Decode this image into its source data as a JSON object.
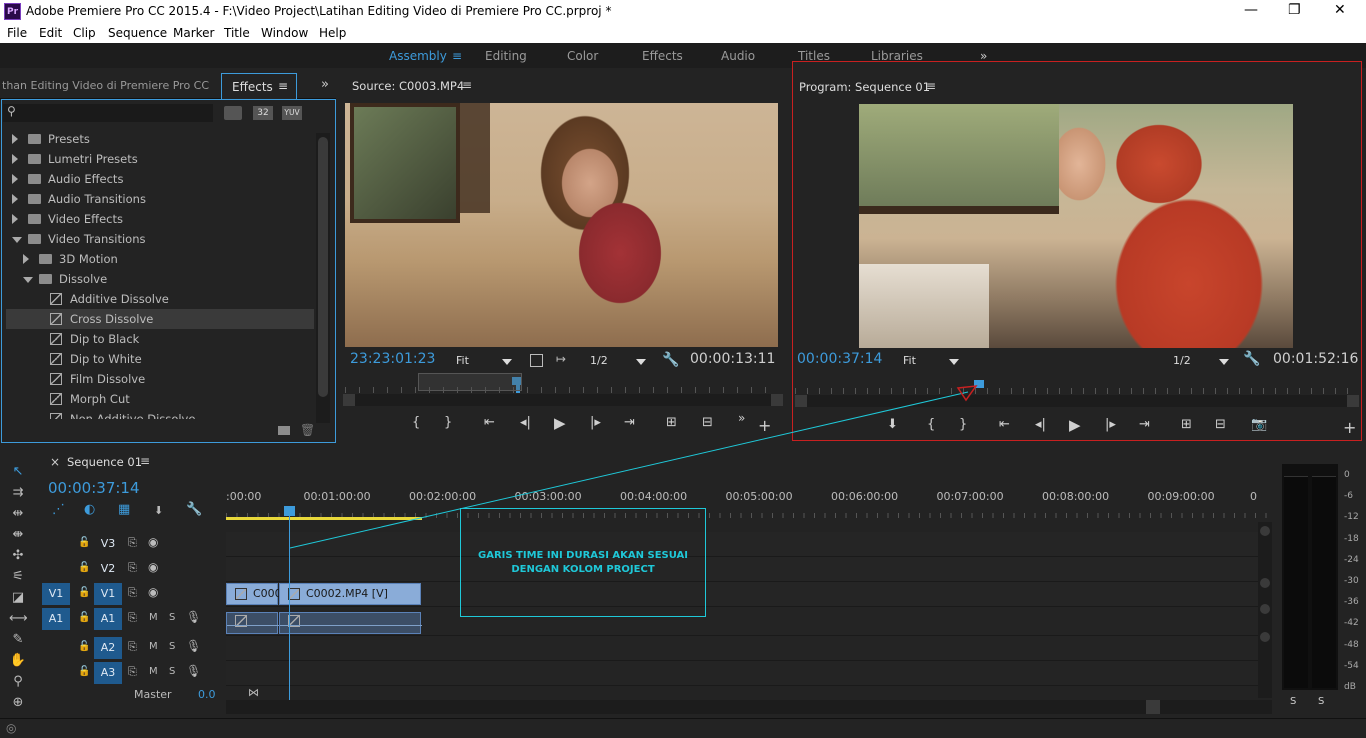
{
  "titlebar": {
    "logo": "Pr",
    "title": "Adobe Premiere Pro CC 2015.4 - F:\\Video Project\\Latihan Editing Video di Premiere Pro CC.prproj *",
    "minimize": "—",
    "restore": "❐",
    "close": "✕"
  },
  "menu": [
    "File",
    "Edit",
    "Clip",
    "Sequence",
    "Marker",
    "Title",
    "Window",
    "Help"
  ],
  "workspaces": {
    "active": "Assembly",
    "items": [
      "Editing",
      "Color",
      "Effects",
      "Audio",
      "Titles",
      "Libraries"
    ],
    "overflow": "»"
  },
  "project_panel": {
    "tab_project": "than Editing Video di Premiere Pro CC",
    "tab_effects": "Effects",
    "menu_icon": "≡",
    "overflow": "»",
    "badges": [
      "32",
      "YUV"
    ],
    "tree": [
      {
        "label": "Presets",
        "expanded": false,
        "level": 0,
        "type": "preset"
      },
      {
        "label": "Lumetri Presets",
        "expanded": false,
        "level": 0,
        "type": "preset"
      },
      {
        "label": "Audio Effects",
        "expanded": false,
        "level": 0,
        "type": "folder"
      },
      {
        "label": "Audio Transitions",
        "expanded": false,
        "level": 0,
        "type": "folder"
      },
      {
        "label": "Video Effects",
        "expanded": false,
        "level": 0,
        "type": "folder"
      },
      {
        "label": "Video Transitions",
        "expanded": true,
        "level": 0,
        "type": "folder"
      },
      {
        "label": "3D Motion",
        "expanded": false,
        "level": 1,
        "type": "folder"
      },
      {
        "label": "Dissolve",
        "expanded": true,
        "level": 1,
        "type": "folder"
      },
      {
        "label": "Additive Dissolve",
        "level": 2,
        "type": "effect"
      },
      {
        "label": "Cross Dissolve",
        "level": 2,
        "type": "effect",
        "selected": true
      },
      {
        "label": "Dip to Black",
        "level": 2,
        "type": "effect"
      },
      {
        "label": "Dip to White",
        "level": 2,
        "type": "effect"
      },
      {
        "label": "Film Dissolve",
        "level": 2,
        "type": "effect"
      },
      {
        "label": "Morph Cut",
        "level": 2,
        "type": "effect"
      },
      {
        "label": "Non Additive Dissolve",
        "level": 2,
        "type": "effect"
      }
    ]
  },
  "source": {
    "title": "Source: C0003.MP4",
    "menu_icon": "≡",
    "timecode": "23:23:01:23",
    "fit": "Fit",
    "resolution": "1/2",
    "duration": "00:00:13:11",
    "overflow": "»",
    "add": "+"
  },
  "program": {
    "title": "Program: Sequence 01",
    "menu_icon": "≡",
    "timecode": "00:00:37:14",
    "fit": "Fit",
    "resolution": "1/2",
    "duration": "00:01:52:16",
    "add": "+"
  },
  "timeline": {
    "close": "×",
    "title": "Sequence 01",
    "menu_icon": "≡",
    "timecode": "00:00:37:14",
    "ruler": [
      ":00:00",
      "00:01:00:00",
      "00:02:00:00",
      "00:03:00:00",
      "00:04:00:00",
      "00:05:00:00",
      "00:06:00:00",
      "00:07:00:00",
      "00:08:00:00",
      "00:09:00:00",
      "0"
    ],
    "tracks": [
      {
        "src": "",
        "name": "V3",
        "kind": "video"
      },
      {
        "src": "",
        "name": "V2",
        "kind": "video"
      },
      {
        "src": "V1",
        "name": "V1",
        "kind": "video"
      },
      {
        "src": "A1",
        "name": "A1",
        "kind": "audio"
      },
      {
        "src": "",
        "name": "A2",
        "kind": "audio"
      },
      {
        "src": "",
        "name": "A3",
        "kind": "audio"
      }
    ],
    "master_label": "Master",
    "master_value": "0.0",
    "clips": [
      {
        "label": "C000"
      },
      {
        "label": "C0002.MP4 [V]"
      }
    ],
    "fx_label": "fx",
    "mute": "M",
    "solo": "S",
    "annotation": "GARIS TIME INI DURASI AKAN SESUAI DENGAN KOLOM PROJECT"
  },
  "meter": {
    "labels": [
      "0",
      "-6",
      "-12",
      "-18",
      "-24",
      "-30",
      "-36",
      "-42",
      "-48",
      "-54",
      "dB"
    ],
    "solo_left": "S",
    "solo_right": "S"
  },
  "colors": {
    "accent": "#3d9bdb",
    "annotation": "#1fc8d8",
    "highlight_box": "#c82020"
  }
}
